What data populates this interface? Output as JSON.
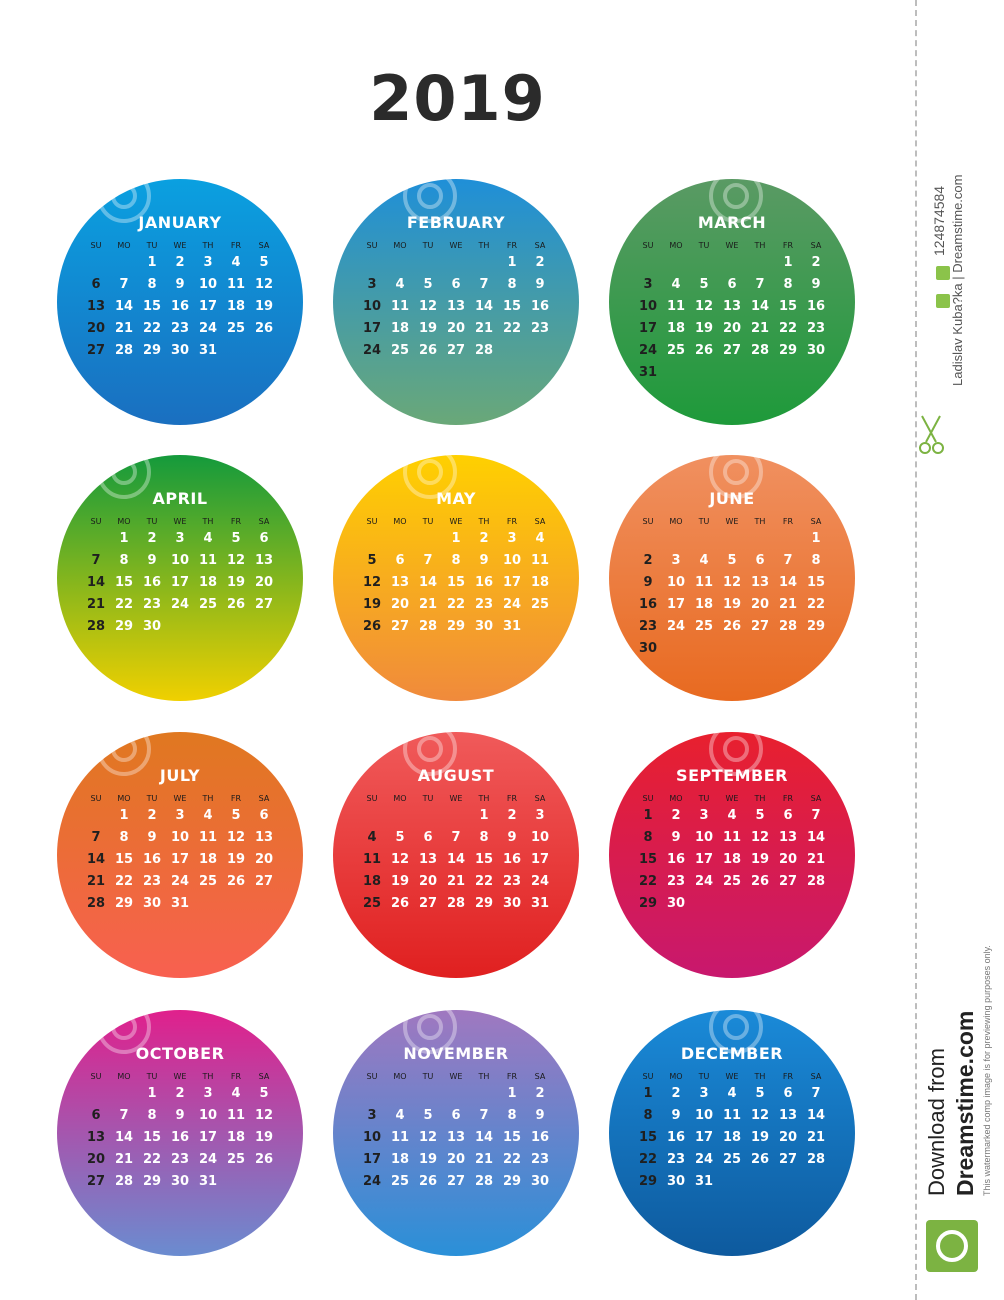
{
  "year": "2019",
  "days_of_week": [
    "SU",
    "MO",
    "TU",
    "WE",
    "TH",
    "FR",
    "SA"
  ],
  "months": [
    {
      "name": "JANUARY",
      "weeks": [
        [
          "",
          "",
          "1",
          "2",
          "3",
          "4",
          "5"
        ],
        [
          "6",
          "7",
          "8",
          "9",
          "10",
          "11",
          "12"
        ],
        [
          "13",
          "14",
          "15",
          "16",
          "17",
          "18",
          "19"
        ],
        [
          "20",
          "21",
          "22",
          "23",
          "24",
          "25",
          "26"
        ],
        [
          "27",
          "28",
          "29",
          "30",
          "31",
          "",
          ""
        ]
      ],
      "gradient": [
        "#0aa0e0",
        "#1a6fc0"
      ]
    },
    {
      "name": "FEBRUARY",
      "weeks": [
        [
          "",
          "",
          "",
          "",
          "",
          "1",
          "2"
        ],
        [
          "3",
          "4",
          "5",
          "6",
          "7",
          "8",
          "9"
        ],
        [
          "10",
          "11",
          "12",
          "13",
          "14",
          "15",
          "16"
        ],
        [
          "17",
          "18",
          "19",
          "20",
          "21",
          "22",
          "23"
        ],
        [
          "24",
          "25",
          "26",
          "27",
          "28",
          "",
          ""
        ]
      ],
      "gradient": [
        "#1f8fd8",
        "#6aa878"
      ]
    },
    {
      "name": "MARCH",
      "weeks": [
        [
          "",
          "",
          "",
          "",
          "",
          "1",
          "2"
        ],
        [
          "3",
          "4",
          "5",
          "6",
          "7",
          "8",
          "9"
        ],
        [
          "10",
          "11",
          "12",
          "13",
          "14",
          "15",
          "16"
        ],
        [
          "17",
          "18",
          "19",
          "20",
          "21",
          "22",
          "23"
        ],
        [
          "24",
          "25",
          "26",
          "27",
          "28",
          "29",
          "30"
        ],
        [
          "31",
          "",
          "",
          "",
          "",
          "",
          ""
        ]
      ],
      "gradient": [
        "#5a9a64",
        "#1e9a3a"
      ]
    },
    {
      "name": "APRIL",
      "weeks": [
        [
          "",
          "1",
          "2",
          "3",
          "4",
          "5",
          "6"
        ],
        [
          "7",
          "8",
          "9",
          "10",
          "11",
          "12",
          "13"
        ],
        [
          "14",
          "15",
          "16",
          "17",
          "18",
          "19",
          "20"
        ],
        [
          "21",
          "22",
          "23",
          "24",
          "25",
          "26",
          "27"
        ],
        [
          "28",
          "29",
          "30",
          "",
          "",
          "",
          ""
        ]
      ],
      "gradient": [
        "#149a3c",
        "#f0d000"
      ]
    },
    {
      "name": "MAY",
      "weeks": [
        [
          "",
          "",
          "",
          "1",
          "2",
          "3",
          "4"
        ],
        [
          "5",
          "6",
          "7",
          "8",
          "9",
          "10",
          "11"
        ],
        [
          "12",
          "13",
          "14",
          "15",
          "16",
          "17",
          "18"
        ],
        [
          "19",
          "20",
          "21",
          "22",
          "23",
          "24",
          "25"
        ],
        [
          "26",
          "27",
          "28",
          "29",
          "30",
          "31",
          ""
        ]
      ],
      "gradient": [
        "#ffd000",
        "#f08a3c"
      ]
    },
    {
      "name": "JUNE",
      "weeks": [
        [
          "",
          "",
          "",
          "",
          "",
          "",
          "1"
        ],
        [
          "2",
          "3",
          "4",
          "5",
          "6",
          "7",
          "8"
        ],
        [
          "9",
          "10",
          "11",
          "12",
          "13",
          "14",
          "15"
        ],
        [
          "16",
          "17",
          "18",
          "19",
          "20",
          "21",
          "22"
        ],
        [
          "23",
          "24",
          "25",
          "26",
          "27",
          "28",
          "29"
        ],
        [
          "30",
          "",
          "",
          "",
          "",
          "",
          ""
        ]
      ],
      "gradient": [
        "#f09060",
        "#e86a20"
      ]
    },
    {
      "name": "JULY",
      "weeks": [
        [
          "",
          "1",
          "2",
          "3",
          "4",
          "5",
          "6"
        ],
        [
          "7",
          "8",
          "9",
          "10",
          "11",
          "12",
          "13"
        ],
        [
          "14",
          "15",
          "16",
          "17",
          "18",
          "19",
          "20"
        ],
        [
          "21",
          "22",
          "23",
          "24",
          "25",
          "26",
          "27"
        ],
        [
          "28",
          "29",
          "30",
          "31",
          "",
          "",
          ""
        ]
      ],
      "gradient": [
        "#e07820",
        "#f86050"
      ]
    },
    {
      "name": "AUGUST",
      "weeks": [
        [
          "",
          "",
          "",
          "",
          "1",
          "2",
          "3"
        ],
        [
          "4",
          "5",
          "6",
          "7",
          "8",
          "9",
          "10"
        ],
        [
          "11",
          "12",
          "13",
          "14",
          "15",
          "16",
          "17"
        ],
        [
          "18",
          "19",
          "20",
          "21",
          "22",
          "23",
          "24"
        ],
        [
          "25",
          "26",
          "27",
          "28",
          "29",
          "30",
          "31"
        ]
      ],
      "gradient": [
        "#f05a5a",
        "#e02020"
      ]
    },
    {
      "name": "SEPTEMBER",
      "weeks": [
        [
          "1",
          "2",
          "3",
          "4",
          "5",
          "6",
          "7"
        ],
        [
          "8",
          "9",
          "10",
          "11",
          "12",
          "13",
          "14"
        ],
        [
          "15",
          "16",
          "17",
          "18",
          "19",
          "20",
          "21"
        ],
        [
          "22",
          "23",
          "24",
          "25",
          "26",
          "27",
          "28"
        ],
        [
          "29",
          "30",
          "",
          "",
          "",
          "",
          ""
        ]
      ],
      "gradient": [
        "#e8202e",
        "#c8186e"
      ]
    },
    {
      "name": "OCTOBER",
      "weeks": [
        [
          "",
          "",
          "1",
          "2",
          "3",
          "4",
          "5"
        ],
        [
          "6",
          "7",
          "8",
          "9",
          "10",
          "11",
          "12"
        ],
        [
          "13",
          "14",
          "15",
          "16",
          "17",
          "18",
          "19"
        ],
        [
          "20",
          "21",
          "22",
          "23",
          "24",
          "25",
          "26"
        ],
        [
          "27",
          "28",
          "29",
          "30",
          "31",
          "",
          ""
        ]
      ],
      "gradient": [
        "#e0208c",
        "#6a8cd0"
      ]
    },
    {
      "name": "NOVEMBER",
      "weeks": [
        [
          "",
          "",
          "",
          "",
          "",
          "1",
          "2"
        ],
        [
          "3",
          "4",
          "5",
          "6",
          "7",
          "8",
          "9"
        ],
        [
          "10",
          "11",
          "12",
          "13",
          "14",
          "15",
          "16"
        ],
        [
          "17",
          "18",
          "19",
          "20",
          "21",
          "22",
          "23"
        ],
        [
          "24",
          "25",
          "26",
          "27",
          "28",
          "29",
          "30"
        ]
      ],
      "gradient": [
        "#a078c0",
        "#2a90d8"
      ]
    },
    {
      "name": "DECEMBER",
      "weeks": [
        [
          "1",
          "2",
          "3",
          "4",
          "5",
          "6",
          "7"
        ],
        [
          "8",
          "9",
          "10",
          "11",
          "12",
          "13",
          "14"
        ],
        [
          "15",
          "16",
          "17",
          "18",
          "19",
          "20",
          "21"
        ],
        [
          "22",
          "23",
          "24",
          "25",
          "26",
          "27",
          "28"
        ],
        [
          "29",
          "30",
          "31",
          "",
          "",
          "",
          ""
        ]
      ],
      "gradient": [
        "#1a8ad8",
        "#0e5a9e"
      ]
    }
  ],
  "watermark": {
    "text": "dreamstime",
    "icon": "dreamstime-spiral-icon"
  },
  "side": {
    "id_badge": "ID",
    "id_number": "124874584",
    "copyright_badge": "©",
    "author": "Ladislav Kuba?ka | Dreamstime.com",
    "download_from": "Download from",
    "brand": "Dreamstime.com",
    "notice": "This watermarked comp image is for previewing purposes only.",
    "accent": "#7cb342"
  }
}
